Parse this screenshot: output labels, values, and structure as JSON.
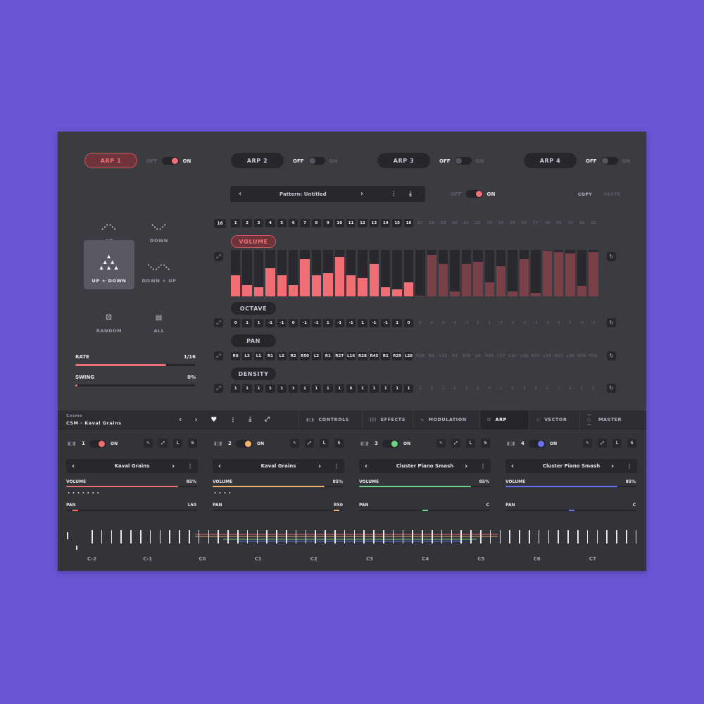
{
  "arp_tabs": [
    {
      "label": "ARP 1",
      "off": "OFF",
      "on": "ON",
      "state": "on",
      "active": true
    },
    {
      "label": "ARP 2",
      "off": "OFF",
      "on": "ON",
      "state": "off",
      "active": false
    },
    {
      "label": "ARP 3",
      "off": "OFF",
      "on": "ON",
      "state": "off",
      "active": false
    },
    {
      "label": "ARP 4",
      "off": "OFF",
      "on": "ON",
      "state": "off",
      "active": false
    }
  ],
  "modes": [
    {
      "label": "UP",
      "icon": "arp-up-icon",
      "selected": false
    },
    {
      "label": "DOWN",
      "icon": "arp-down-icon",
      "selected": false
    },
    {
      "label": "UP + DOWN",
      "icon": "arp-up-down-icon",
      "selected": true
    },
    {
      "label": "DOWN + UP",
      "icon": "arp-down-up-icon",
      "selected": false
    },
    {
      "label": "RANDOM",
      "icon": "dice-icon",
      "selected": false
    },
    {
      "label": "ALL",
      "icon": "keyboard-icon",
      "selected": false
    }
  ],
  "rate": {
    "label": "RATE",
    "value": "1/16",
    "level": 0.76
  },
  "swing": {
    "label": "SWING",
    "value": "0%",
    "level": 0.01
  },
  "pattern": {
    "name": "Pattern: Untitled",
    "off": "OFF",
    "on": "ON",
    "copy": "COPY",
    "paste": "PASTE"
  },
  "step_count": "16",
  "steps": [
    "1",
    "2",
    "3",
    "4",
    "5",
    "6",
    "7",
    "8",
    "9",
    "10",
    "11",
    "12",
    "13",
    "14",
    "15",
    "16",
    "17",
    "18",
    "19",
    "20",
    "21",
    "22",
    "23",
    "24",
    "25",
    "26",
    "27",
    "28",
    "29",
    "30",
    "31",
    "32"
  ],
  "volume": {
    "label": "VOLUME",
    "values": [
      0.45,
      0.25,
      0.2,
      0.6,
      0.45,
      0.25,
      0.8,
      0.45,
      0.5,
      0.85,
      0.45,
      0.4,
      0.7,
      0.2,
      0.15,
      0.3,
      0.02,
      0.9,
      0.7,
      0.1,
      0.7,
      0.75,
      0.3,
      0.65,
      0.1,
      0.8,
      0.08,
      0.98,
      0.95,
      0.92,
      0.22,
      0.95,
      0.25
    ]
  },
  "octave": {
    "label": "OCTAVE",
    "values": [
      "0",
      "1",
      "1",
      "-1",
      "-1",
      "0",
      "-1",
      "-1",
      "1",
      "-1",
      "-1",
      "1",
      "-1",
      "-1",
      "1",
      "0",
      "1",
      "0",
      "0",
      "-1",
      "-1",
      "1",
      "1",
      "-1",
      "-1",
      "-1",
      "-1",
      "-1",
      "1",
      "1",
      "-1",
      "-1"
    ]
  },
  "pan": {
    "label": "PAN",
    "values": [
      "R8",
      "L3",
      "L1",
      "R1",
      "L5",
      "R2",
      "R50",
      "L2",
      "R1",
      "R27",
      "L16",
      "R28",
      "R45",
      "R1",
      "R29",
      "L28",
      "R10",
      "R8",
      "L31",
      "R4",
      "R18",
      "L8",
      "R29",
      "L17",
      "L42",
      "L38",
      "R31",
      "L34",
      "R11",
      "L28",
      "R25",
      "R16"
    ]
  },
  "density": {
    "label": "DENSITY",
    "values": [
      "1",
      "1",
      "1",
      "1",
      "1",
      "1",
      "1",
      "1",
      "1",
      "1",
      "6",
      "1",
      "1",
      "1",
      "1",
      "1",
      "1",
      "1",
      "1",
      "1",
      "1",
      "1",
      "4",
      "1",
      "1",
      "1",
      "1",
      "1",
      "1",
      "1",
      "1",
      "1"
    ]
  },
  "header": {
    "brand": "Cosmo",
    "preset": "CSM - Kaval Grains"
  },
  "tabs": [
    {
      "label": "CONTROLS",
      "icon": "waveform-icon"
    },
    {
      "label": "EFFECTS",
      "icon": "effects-icon"
    },
    {
      "label": "MODULATION",
      "icon": "modulation-icon"
    },
    {
      "label": "ARP",
      "icon": "arp-icon",
      "current": true
    },
    {
      "label": "VECTOR",
      "icon": "vector-icon"
    },
    {
      "label": "MASTER",
      "icon": "fader-icon"
    }
  ],
  "channels": [
    {
      "num": "1",
      "on": "ON",
      "color": "#f06e74",
      "preset": "Kaval Grains",
      "vol_label": "VOLUME",
      "vol": "85%",
      "vol_level": 0.85,
      "pan_label": "PAN",
      "pan": "L50",
      "pan_pos": 0.05,
      "dots": "• • • • • • •",
      "btn_l": "L",
      "btn_s": "S"
    },
    {
      "num": "2",
      "on": "ON",
      "color": "#f0b46e",
      "preset": "Kaval Grains",
      "vol_label": "VOLUME",
      "vol": "85%",
      "vol_level": 0.85,
      "pan_label": "PAN",
      "pan": "R50",
      "pan_pos": 0.96,
      "dots": "• • • •",
      "btn_l": "L",
      "btn_s": "S"
    },
    {
      "num": "3",
      "on": "ON",
      "color": "#6ed48a",
      "preset": "Cluster Piano Smash",
      "vol_label": "VOLUME",
      "vol": "85%",
      "vol_level": 0.85,
      "pan_label": "PAN",
      "pan": "C",
      "pan_pos": 0.5,
      "dots": "",
      "btn_l": "L",
      "btn_s": "S"
    },
    {
      "num": "4",
      "on": "ON",
      "color": "#6a6ef0",
      "preset": "Cluster Piano Smash",
      "vol_label": "VOLUME",
      "vol": "85%",
      "vol_level": 0.85,
      "pan_label": "PAN",
      "pan": "C",
      "pan_pos": 0.5,
      "dots": "",
      "btn_l": "L",
      "btn_s": "S"
    }
  ],
  "octaves": [
    "C-2",
    "C-1",
    "C0",
    "C1",
    "C2",
    "C3",
    "C4",
    "C5",
    "C6",
    "C7"
  ]
}
